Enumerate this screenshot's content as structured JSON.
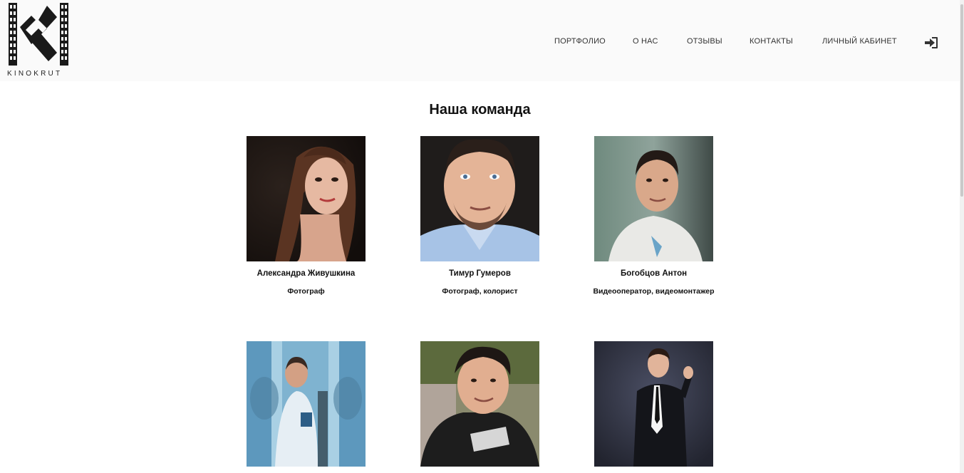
{
  "header": {
    "logo_text": "KINOKRUT",
    "nav": [
      {
        "label": "ПОРТФОЛИО"
      },
      {
        "label": "О НАС"
      },
      {
        "label": "ОТЗЫВЫ"
      },
      {
        "label": "КОНТАКТЫ"
      },
      {
        "label": "ЛИЧНЫЙ КАБИНЕТ"
      }
    ],
    "login_icon": "sign-in-icon"
  },
  "team": {
    "title": "Наша команда",
    "members": [
      {
        "name": "Александра Живушкина",
        "role": "Фотограф"
      },
      {
        "name": "Тимур Гумеров",
        "role": "Фотограф, колорист"
      },
      {
        "name": "Богобцов Антон",
        "role": "Видеооператор, видеомонтажер"
      },
      {
        "name": "",
        "role": ""
      },
      {
        "name": "",
        "role": ""
      },
      {
        "name": "",
        "role": ""
      }
    ]
  }
}
